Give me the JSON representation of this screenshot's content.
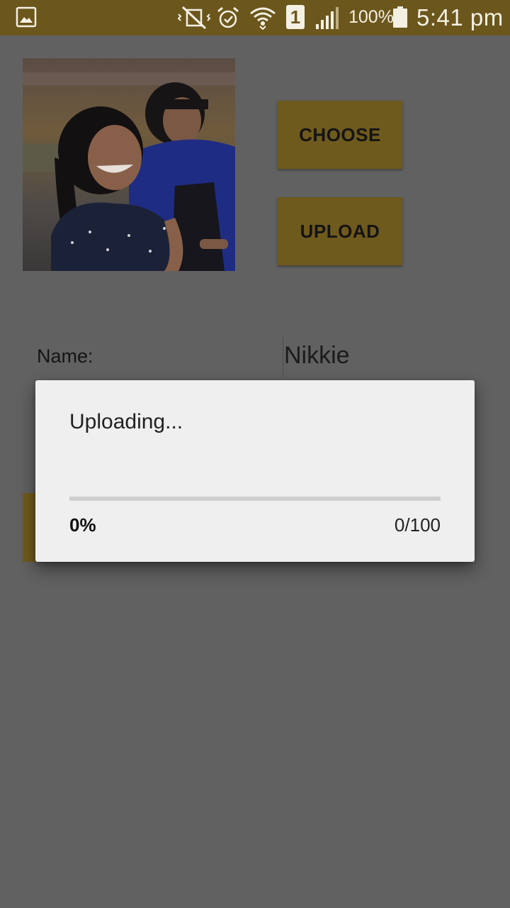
{
  "status_bar": {
    "battery_percent": "100%",
    "time": "5:41 pm",
    "sim_slot": "1",
    "icons": [
      "gallery-icon",
      "mute-vibrate-icon",
      "alarm-icon",
      "wifi-icon",
      "sim-icon",
      "signal-icon",
      "battery-icon"
    ]
  },
  "main": {
    "photo": {
      "subject": "photo of two girls"
    },
    "choose_label": "CHOOSE",
    "upload_label": "UPLOAD",
    "name_label": "Name:",
    "name_value": "Nikkie"
  },
  "dialog": {
    "title": "Uploading...",
    "progress_fraction": 0,
    "progress_percent": "0%",
    "progress_count": "0/100"
  },
  "colors": {
    "status_bar": "#6b561c",
    "button": "#6f5a1d",
    "scrim_background": "#616161",
    "dialog_background": "#efefef"
  }
}
